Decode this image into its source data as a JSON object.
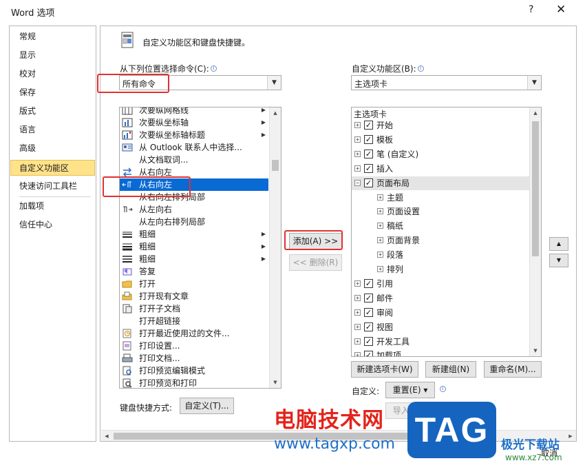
{
  "window": {
    "title": "Word 选项",
    "help": "?",
    "close": "✕"
  },
  "nav": {
    "items": [
      "常规",
      "显示",
      "校对",
      "保存",
      "版式",
      "语言",
      "高级",
      "自定义功能区",
      "快速访问工具栏",
      "加载项",
      "信任中心"
    ],
    "active": "自定义功能区"
  },
  "header": {
    "text": "自定义功能区和键盘快捷键。"
  },
  "left": {
    "label": "从下列位置选择命令(C):",
    "info": "i",
    "combo_value": "所有命令",
    "commands": [
      {
        "label": "次要纵网格线",
        "icon": "gridlines-icon",
        "arrow": true
      },
      {
        "label": "次要纵坐标轴",
        "icon": "axis-icon",
        "arrow": true
      },
      {
        "label": "次要纵坐标轴标题",
        "icon": "axis-title-icon",
        "arrow": true
      },
      {
        "label": "从 Outlook 联系人中选择...",
        "icon": "contacts-icon",
        "arrow": false
      },
      {
        "label": "从文档取词...",
        "icon": "",
        "arrow": false
      },
      {
        "label": "从右向左",
        "icon": "rtl-swap-icon",
        "arrow": false
      },
      {
        "label": "从右向左",
        "icon": "rtl-paragraph-icon",
        "arrow": false,
        "selected": true
      },
      {
        "label": "从右向左排列局部",
        "icon": "",
        "arrow": false
      },
      {
        "label": "从左向右",
        "icon": "ltr-paragraph-icon",
        "arrow": false
      },
      {
        "label": "从左向右排列局部",
        "icon": "",
        "arrow": false
      },
      {
        "label": "粗细",
        "icon": "line-weight-thin-icon",
        "arrow": true
      },
      {
        "label": "粗细",
        "icon": "line-weight-thick-icon",
        "arrow": true
      },
      {
        "label": "粗细",
        "icon": "line-weight-list-icon",
        "arrow": true
      },
      {
        "label": "答复",
        "icon": "reply-icon",
        "arrow": false
      },
      {
        "label": "打开",
        "icon": "open-folder-icon",
        "arrow": false
      },
      {
        "label": "打开现有文章",
        "icon": "open-article-icon",
        "arrow": false
      },
      {
        "label": "打开子文档",
        "icon": "open-subdocument-icon",
        "arrow": false
      },
      {
        "label": "打开超链接",
        "icon": "",
        "arrow": false
      },
      {
        "label": "打开最近使用过的文件...",
        "icon": "recent-file-icon",
        "arrow": false
      },
      {
        "label": "打印设置...",
        "icon": "print-setup-icon",
        "arrow": false
      },
      {
        "label": "打印文档...",
        "icon": "print-document-icon",
        "arrow": false
      },
      {
        "label": "打印预览编辑模式",
        "icon": "print-preview-edit-icon",
        "arrow": false
      },
      {
        "label": "打印预览和打印",
        "icon": "print-preview-icon",
        "arrow": false
      }
    ],
    "shortcut_label": "键盘快捷方式:",
    "shortcut_button": "自定义(T)..."
  },
  "middle": {
    "add_button": "添加(A) >>",
    "remove_button": "<< 删除(R)"
  },
  "right": {
    "label": "自定义功能区(B):",
    "info": "i",
    "combo_value": "主选项卡",
    "tree_header": "主选项卡",
    "tree": [
      {
        "label": "开始",
        "level": 0,
        "expander": "+",
        "checked": true
      },
      {
        "label": "模板",
        "level": 0,
        "expander": "+",
        "checked": true
      },
      {
        "label": "笔 (自定义)",
        "level": 0,
        "expander": "+",
        "checked": true
      },
      {
        "label": "插入",
        "level": 0,
        "expander": "+",
        "checked": true
      },
      {
        "label": "页面布局",
        "level": 0,
        "expander": "−",
        "checked": true,
        "highlight": true
      },
      {
        "label": "主题",
        "level": 1,
        "expander": "+"
      },
      {
        "label": "页面设置",
        "level": 1,
        "expander": "+"
      },
      {
        "label": "稿纸",
        "level": 1,
        "expander": "+"
      },
      {
        "label": "页面背景",
        "level": 1,
        "expander": "+"
      },
      {
        "label": "段落",
        "level": 1,
        "expander": "+"
      },
      {
        "label": "排列",
        "level": 1,
        "expander": "+"
      },
      {
        "label": "引用",
        "level": 0,
        "expander": "+",
        "checked": true
      },
      {
        "label": "邮件",
        "level": 0,
        "expander": "+",
        "checked": true
      },
      {
        "label": "审阅",
        "level": 0,
        "expander": "+",
        "checked": true
      },
      {
        "label": "视图",
        "level": 0,
        "expander": "+",
        "checked": true
      },
      {
        "label": "开发工具",
        "level": 0,
        "expander": "+",
        "checked": true
      },
      {
        "label": "加载项",
        "level": 0,
        "expander": "+",
        "checked": true
      }
    ],
    "new_tab_button": "新建选项卡(W)",
    "new_group_button": "新建组(N)",
    "rename_button": "重命名(M)...",
    "customize_label": "自定义:",
    "reset_button": "重置(E) ▾",
    "import_export_button": "导入/导出(P) ▾",
    "move_up": "▲",
    "move_down": "▼"
  },
  "footer": {
    "cancel": "取消"
  },
  "watermark": {
    "site_cn": "电脑技术网",
    "site_url": "www.tagxp.com",
    "tag": "TAG",
    "site2_cn": "极光下载站",
    "site2_url": "www.xz7.com"
  },
  "colors": {
    "selection": "#0a6ad4",
    "nav_active": "#ffe38b",
    "annotation": "#e03131"
  }
}
